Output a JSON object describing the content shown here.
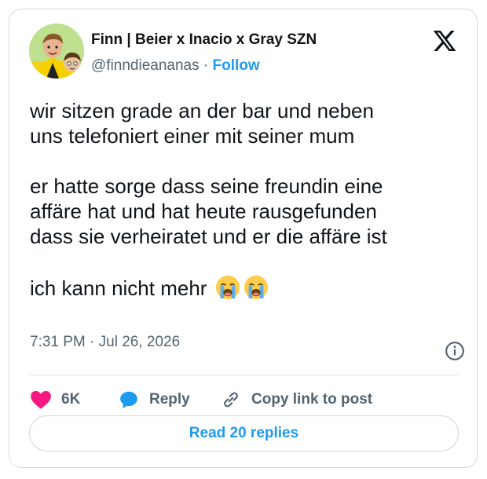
{
  "tweet": {
    "author_name": "Finn | Beier x Inacio x Gray SZN",
    "handle": "@finndieananas",
    "separator": " · ",
    "follow_label": "Follow",
    "paragraphs": [
      "wir sitzen grade an der bar und neben\nuns telefoniert einer mit seiner mum",
      "er hatte sorge dass seine freundin eine\naffäre hat und hat heute rausgefunden\ndass sie verheiratet und er die affäre ist",
      "ich kann nicht mehr"
    ],
    "emojis": [
      "loudly-crying-face",
      "loudly-crying-face"
    ],
    "timestamp": "7:31 PM · Jul 26, 2026"
  },
  "actions": {
    "like_count": "6K",
    "reply_label": "Reply",
    "copy_label": "Copy link to post"
  },
  "footer": {
    "read_replies_label": "Read 20 replies"
  },
  "colors": {
    "accent": "#1d9bf0",
    "like": "#f91880",
    "muted": "#536471",
    "text": "#0f1419"
  }
}
